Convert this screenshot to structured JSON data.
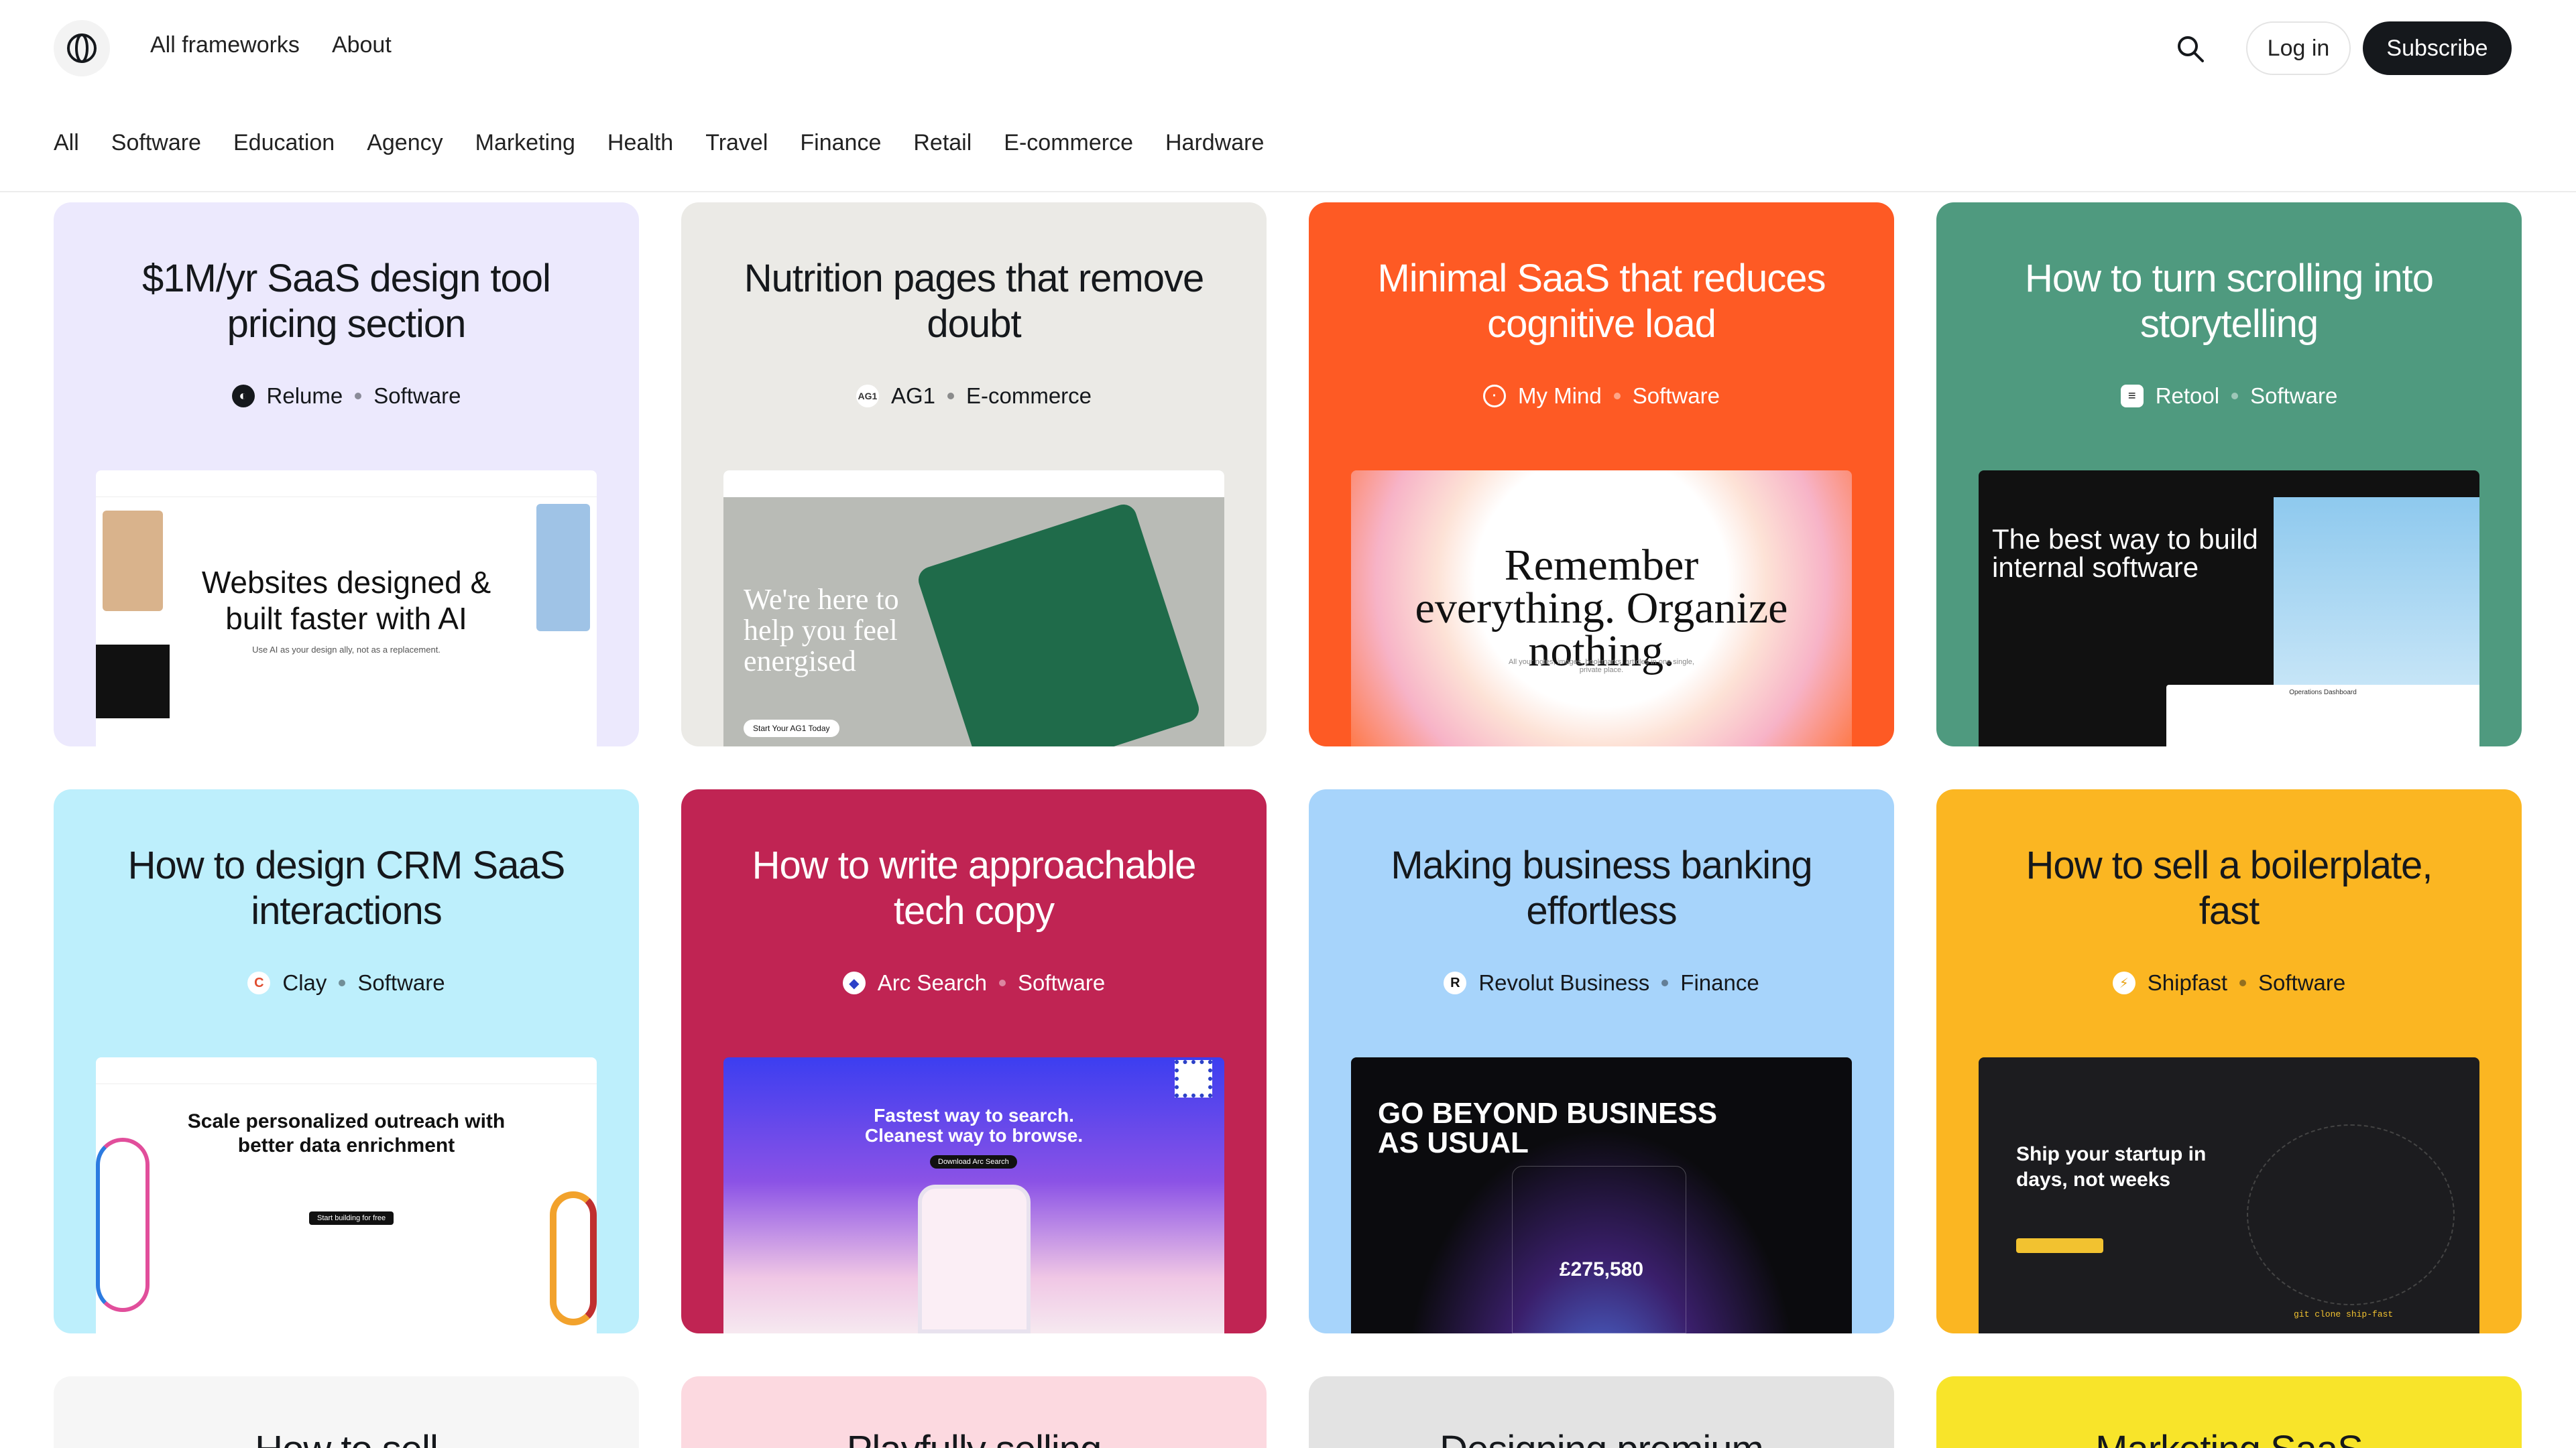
{
  "header": {
    "nav": [
      "All frameworks",
      "About"
    ],
    "login_label": "Log in",
    "subscribe_label": "Subscribe"
  },
  "categories": [
    "All",
    "Software",
    "Education",
    "Agency",
    "Marketing",
    "Health",
    "Travel",
    "Finance",
    "Retail",
    "E-commerce",
    "Hardware"
  ],
  "cards": [
    {
      "title": "$1M/yr SaaS design tool pricing section",
      "brand": "Relume",
      "category": "Software",
      "bg": "#ece9fd",
      "fg": "#15181c",
      "shot": {
        "headline": "Websites designed & built faster with AI",
        "sub": "Use AI as your design ally, not as a replacement."
      }
    },
    {
      "title": "Nutrition pages that remove doubt",
      "brand": "AG1",
      "category": "E-commerce",
      "bg": "#ebeae6",
      "fg": "#15181c",
      "shot": {
        "headline": "We're here to help you feel energised",
        "sub": "Start Your AG1 Today"
      }
    },
    {
      "title": "Minimal SaaS that reduces cognitive load",
      "brand": "My Mind",
      "category": "Software",
      "bg": "#fe5a24",
      "fg": "#ffffff",
      "shot": {
        "headline": "Remember everything. Organize nothing.",
        "sub": "All your notes, images, bookmarks, articles in one single, private place."
      }
    },
    {
      "title": "How to turn scrolling into storytelling",
      "brand": "Retool",
      "category": "Software",
      "bg": "#4f9a7f",
      "fg": "#ffffff",
      "shot": {
        "headline": "The best way to build internal software",
        "sub": "Operations Dashboard"
      }
    },
    {
      "title": "How to design CRM SaaS interactions",
      "brand": "Clay",
      "category": "Software",
      "bg": "#bdeffc",
      "fg": "#15181c",
      "shot": {
        "headline": "Scale personalized outreach with better data enrichment",
        "sub": "Start building for free"
      }
    },
    {
      "title": "How to write approachable tech copy",
      "brand": "Arc Search",
      "category": "Software",
      "bg": "#c02453",
      "fg": "#ffffff",
      "shot": {
        "headline": "Fastest way to search. Cleanest way to browse.",
        "sub": "Download Arc Search"
      }
    },
    {
      "title": "Making business banking effortless",
      "brand": "Revolut Business",
      "category": "Finance",
      "bg": "#a7d4fb",
      "fg": "#15181c",
      "shot": {
        "headline": "GO BEYOND BUSINESS AS USUAL",
        "sub": "£275,580"
      }
    },
    {
      "title": "How to sell a boilerplate, fast",
      "brand": "Shipfast",
      "category": "Software",
      "bg": "#fbb622",
      "fg": "#15181c",
      "shot": {
        "headline": "Ship your startup in days, not weeks",
        "sub": "git clone ship-fast"
      }
    }
  ],
  "partial_cards": [
    {
      "title": "How to sell",
      "bg": "#f6f6f6"
    },
    {
      "title": "Playfully selling",
      "bg": "#fcd9e0"
    },
    {
      "title": "Designing premium",
      "bg": "#e3e3e3"
    },
    {
      "title": "Marketing SaaS",
      "bg": "#f8e42a"
    }
  ]
}
